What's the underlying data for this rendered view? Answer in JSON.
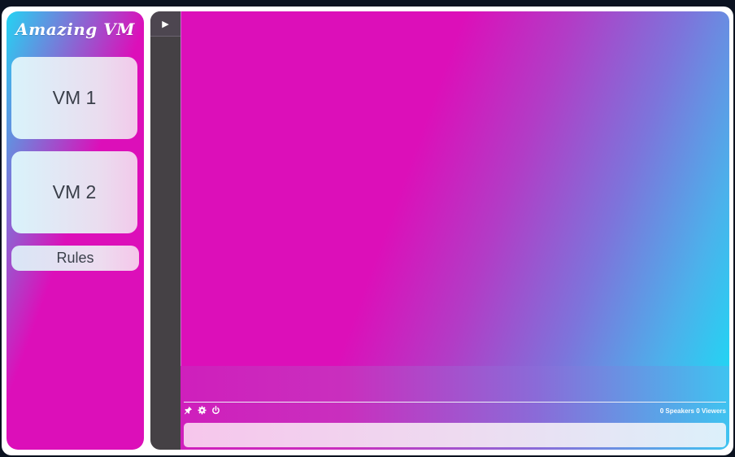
{
  "sidebar": {
    "brand": "Amazing VM",
    "vms": [
      {
        "label": "VM 1"
      },
      {
        "label": "VM 2"
      }
    ],
    "rules_label": "Rules"
  },
  "viewer": {
    "play_glyph": "▶",
    "status": {
      "speakers_count": "0",
      "speakers_label": "Speakers",
      "viewers_count": "0",
      "viewers_label": "Viewers"
    },
    "tools": [
      "pin-icon",
      "gear-icon",
      "power-icon"
    ],
    "chat": {
      "value": "",
      "placeholder": ""
    }
  },
  "colors": {
    "magenta": "#dc0fb9",
    "cyan": "#24d3f3",
    "rail": "#454145"
  }
}
